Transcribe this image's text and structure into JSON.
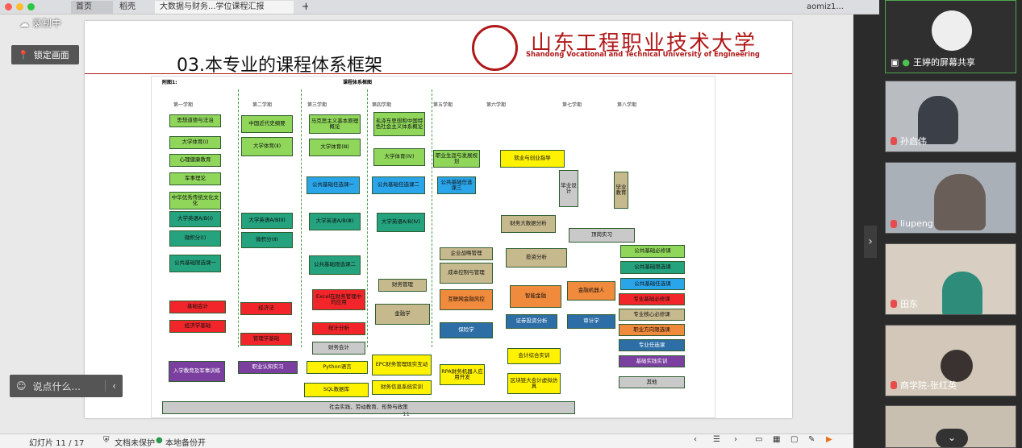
{
  "window": {
    "tabs": [
      "首页",
      "稻壳",
      "大数据与财务...学位课程汇报"
    ],
    "user": "aomiz1..."
  },
  "overlay": {
    "recording": "录制中",
    "lock": "锁定画面",
    "chat_placeholder": "说点什么..."
  },
  "slide": {
    "title": "03.本专业的课程体系框架",
    "university_cn": "山东工程职业技术大学",
    "university_en": "Shandong Vocational and Technical University of Engineering",
    "figure_label": "附图1:",
    "chart_title": "课程体系框图",
    "page_no": "11",
    "semesters": [
      "第一学期",
      "第二学期",
      "第三学期",
      "第四学期",
      "第五学期",
      "第六学期",
      "第七学期",
      "第八学期"
    ],
    "boxes": {
      "s1": [
        "思想道德与法治",
        "大学体育(Ⅰ)",
        "心理健康教育",
        "军事理论",
        "中华优秀传统文化文化",
        "大学英语A/B(Ⅰ)",
        "微积分(Ⅰ)",
        "公共基础限选课一"
      ],
      "s2": [
        "中国近代史纲要",
        "大学体育(Ⅱ)",
        "大学英语A/B(Ⅱ)",
        "微积分(Ⅱ)"
      ],
      "s3": [
        "马克思主义基本原理概论",
        "大学体育(Ⅲ)",
        "公共基础任选课一",
        "大学英语A/B(Ⅲ)",
        "公共基础限选课二"
      ],
      "s4": [
        "毛泽东思想和中国特色社会主义体系概论",
        "大学体育(Ⅳ)",
        "公共基础任选课二",
        "大学英语A/B(Ⅳ)"
      ],
      "s5": [
        "职业生涯与发展规划",
        "公共基础任选课三",
        "企业战略管理",
        "成本控制与管理",
        "互联网金融风控",
        "保险学"
      ],
      "s6": [
        "就业与创业指导",
        "财务大数据分析",
        "投资分析",
        "智能金融",
        "证券投资分析"
      ],
      "s7": [
        "毕业设计",
        "顶岗实习",
        "金融机器人",
        "审计学"
      ],
      "s8": [
        "毕业教育"
      ],
      "other": [
        "财务管理",
        "金融学",
        "基础会计",
        "经济学基础",
        "经济法",
        "管理学基础",
        "Excel在财务管理中的应用",
        "统计分析",
        "财务会计",
        "入学教育及军事训练",
        "职业认知实习",
        "Python语言",
        "SQL数据库",
        "EPC财务管理现实互动",
        "财务信息系统实训",
        "RPA财务机器人应用开发",
        "会计综合实训",
        "区块链大会计虚拟仿真",
        "社会实践、劳动教育、形势与政策"
      ]
    },
    "legend": [
      "公共基础必修课",
      "公共基础限选课",
      "公共基础任选课",
      "专业基础必修课",
      "专业核心必修课",
      "职业方向限选课",
      "专业任选课",
      "基础实践实训",
      "其他"
    ]
  },
  "participants": [
    {
      "name": "王婷的屏幕共享"
    },
    {
      "name": "孙启伟"
    },
    {
      "name": "liupeng"
    },
    {
      "name": "田东"
    },
    {
      "name": "商学院-张红英"
    }
  ],
  "status": {
    "slide": "幻灯片 11 / 17",
    "protect": "文档未保护",
    "backup": "本地备份开"
  }
}
